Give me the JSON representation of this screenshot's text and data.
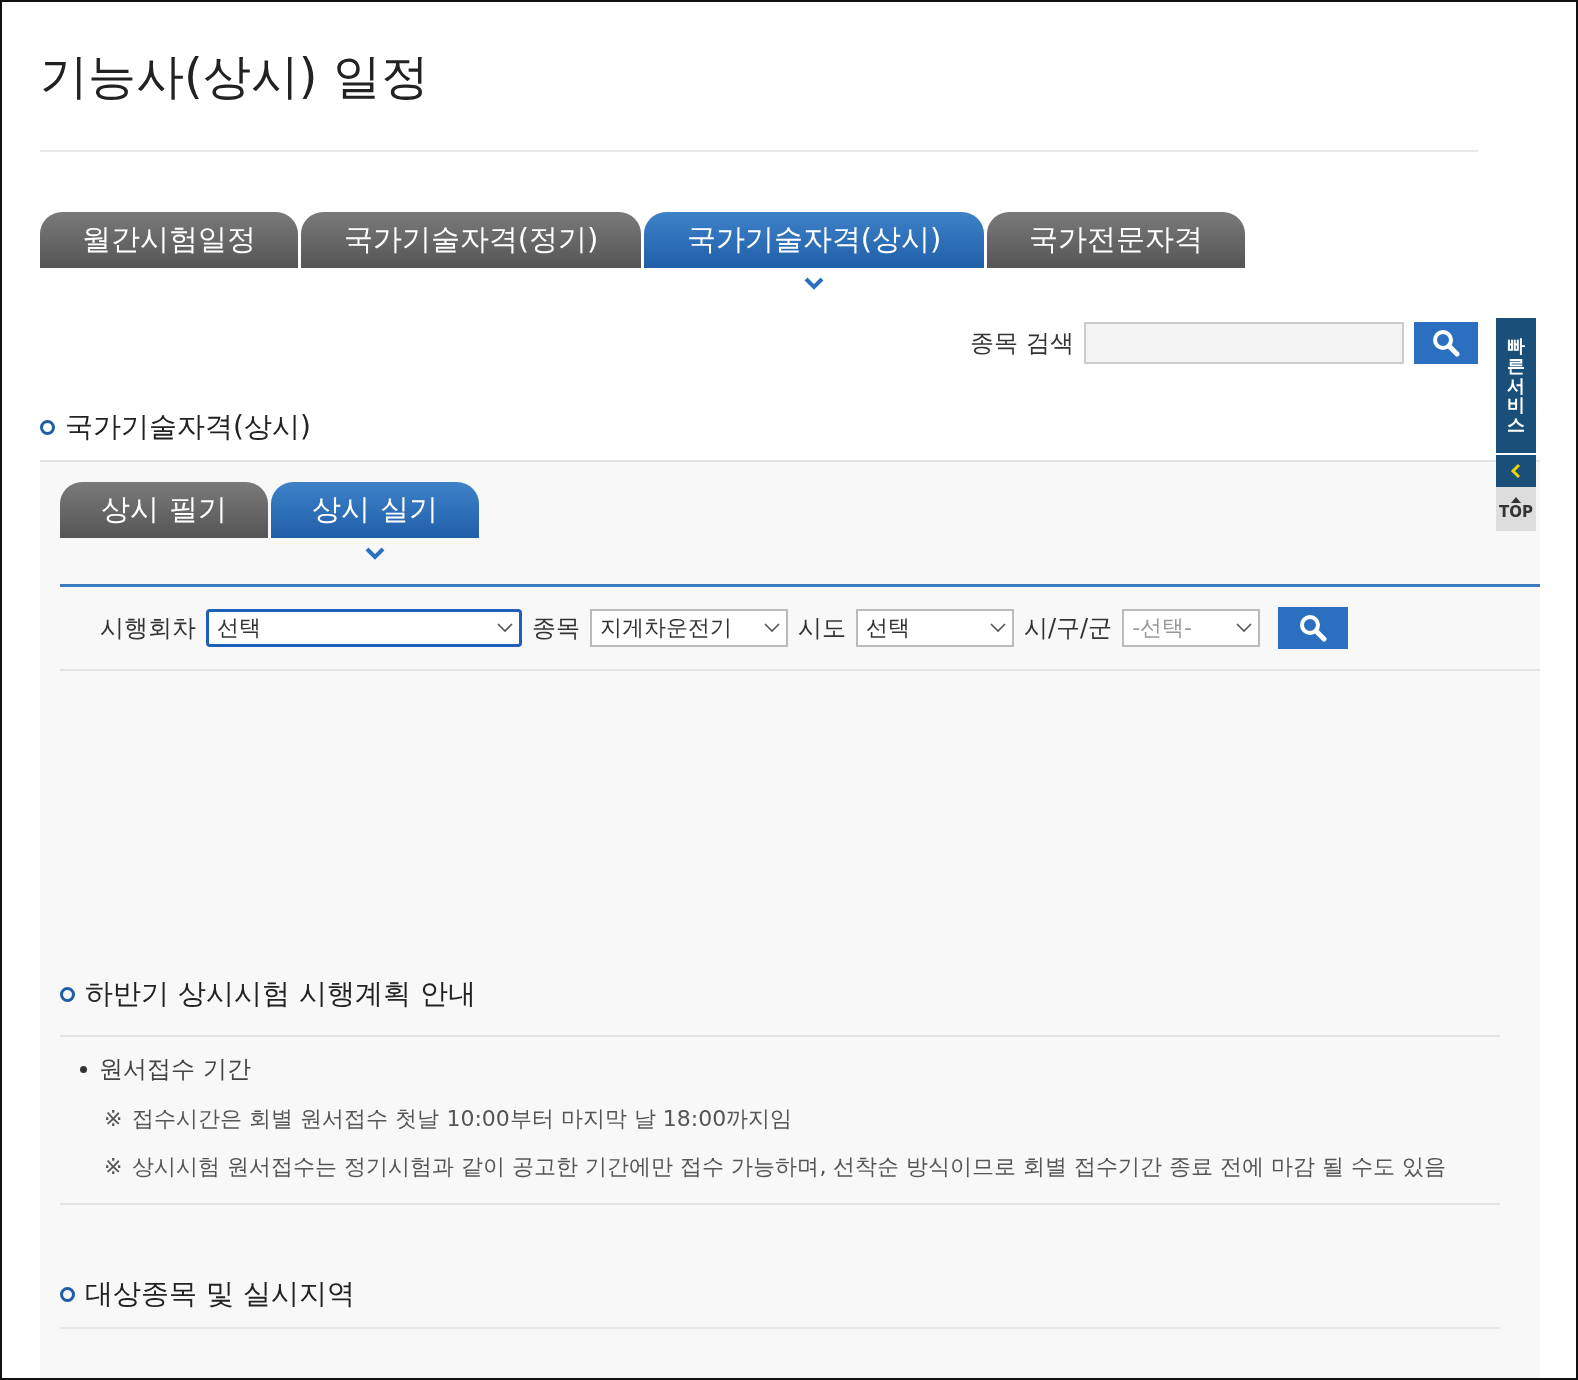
{
  "page_title": "기능사(상시) 일정",
  "tabs": [
    {
      "label": "월간시험일정",
      "selected": false
    },
    {
      "label": "국가기술자격(정기)",
      "selected": false
    },
    {
      "label": "국가기술자격(상시)",
      "selected": true
    },
    {
      "label": "국가전문자격",
      "selected": false
    }
  ],
  "search": {
    "label": "종목 검색"
  },
  "section_title": "국가기술자격(상시)",
  "sub_tabs": [
    {
      "label": "상시 필기",
      "selected": false
    },
    {
      "label": "상시 실기",
      "selected": true
    }
  ],
  "filters": [
    {
      "label": "시행회차",
      "value": "선택",
      "focused": true,
      "disabled": false
    },
    {
      "label": "종목",
      "value": "지게차운전기",
      "focused": false,
      "disabled": false
    },
    {
      "label": "시도",
      "value": "선택",
      "focused": false,
      "disabled": false
    },
    {
      "label": "시/구/군",
      "value": "-선택-",
      "focused": false,
      "disabled": true
    }
  ],
  "plan": {
    "title": "하반기 상시시험 시행계획 안내",
    "item": "원서접수 기간",
    "notes": [
      {
        "mark": "※",
        "text": "접수시간은 회별 원서접수 첫날 10:00부터 마지막 날 18:00까지임"
      },
      {
        "mark": "※",
        "text": "상시시험 원서접수는 정기시험과 같이 공고한 기간에만 접수 가능하며, 선착순 방식이므로 회별 접수기간 종료 전에 마감 될 수도 있음"
      }
    ]
  },
  "targets_title": "대상종목 및 실시지역",
  "quick_service": {
    "label": "빠른서비스",
    "top_label": "TOP"
  }
}
